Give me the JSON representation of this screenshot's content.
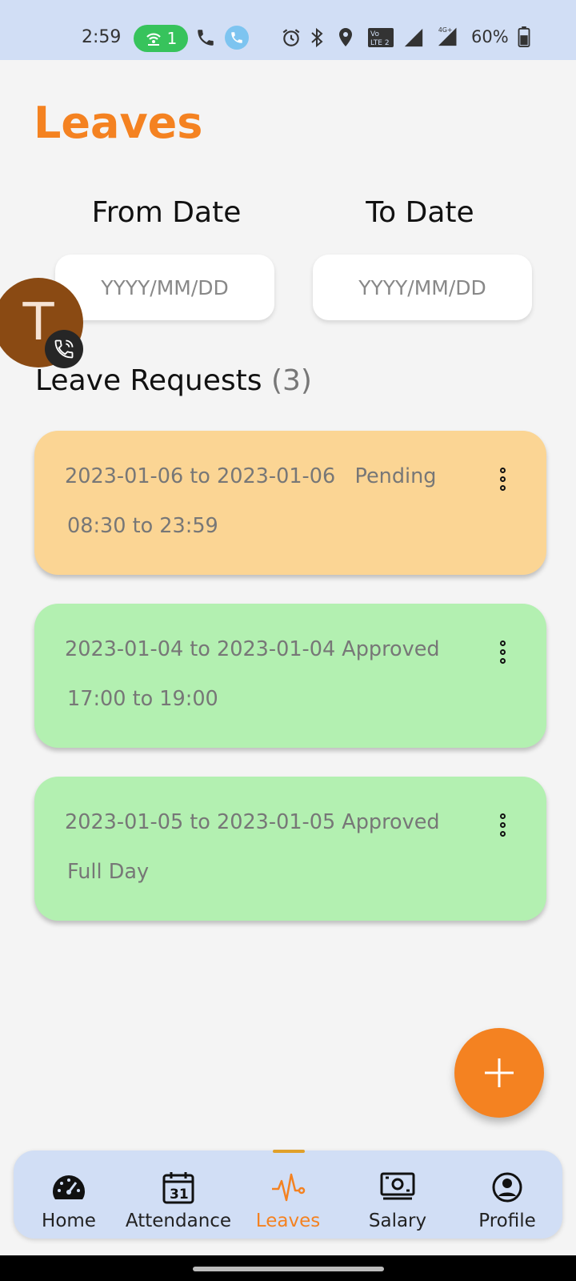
{
  "status_bar": {
    "time": "2:59",
    "hotspot_count": "1",
    "battery": "60%"
  },
  "page": {
    "title": "Leaves"
  },
  "filters": {
    "from_label": "From Date",
    "to_label": "To Date",
    "from_placeholder": "YYYY/MM/DD",
    "to_placeholder": "YYYY/MM/DD"
  },
  "avatar": {
    "initial": "T"
  },
  "requests": {
    "title": "Leave Requests",
    "count": "(3)",
    "items": [
      {
        "dates": "2023-01-06 to 2023-01-06   Pending",
        "time": "08:30 to 23:59",
        "color": "#fbd594"
      },
      {
        "dates": "2023-01-04 to 2023-01-04 Approved",
        "time": "17:00 to 19:00",
        "color": "#b3f0b1"
      },
      {
        "dates": "2023-01-05 to 2023-01-05 Approved",
        "time": "Full Day",
        "color": "#b3f0b1"
      }
    ]
  },
  "nav": {
    "items": [
      {
        "label": "Home",
        "icon": "speedometer-icon"
      },
      {
        "label": "Attendance",
        "icon": "calendar-icon"
      },
      {
        "label": "Leaves",
        "icon": "pulse-icon"
      },
      {
        "label": "Salary",
        "icon": "money-icon"
      },
      {
        "label": "Profile",
        "icon": "profile-icon"
      }
    ],
    "calendar_day": "31"
  },
  "colors": {
    "accent": "#f48221",
    "status_bar": "#d1def5",
    "pending": "#fbd594",
    "approved": "#b3f0b1"
  }
}
